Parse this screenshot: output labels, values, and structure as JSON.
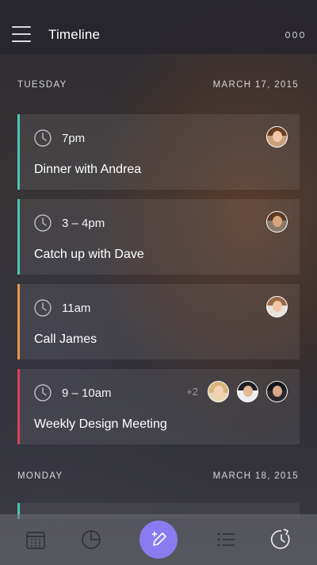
{
  "header": {
    "title": "Timeline",
    "menu_icon": "hamburger-menu-icon",
    "more_icon": "more-options-icon"
  },
  "days": [
    {
      "name": "TUESDAY",
      "date": "MARCH 17, 2015",
      "events": [
        {
          "time": "7pm",
          "title": "Dinner with Andrea",
          "accent": "#4cc4b8",
          "attendees": [
            "andrea-avatar"
          ]
        },
        {
          "time": "3 – 4pm",
          "title": "Catch up with Dave",
          "accent": "#4cc4b8",
          "attendees": [
            "dave-avatar"
          ]
        },
        {
          "time": "11am",
          "title": "Call James",
          "accent": "#e8974a",
          "attendees": [
            "james-avatar"
          ]
        },
        {
          "time": "9 – 10am",
          "title": "Weekly Design Meeting",
          "accent": "#d9405a",
          "extra": "+2",
          "attendees": [
            "attendee-avatar-1",
            "attendee-avatar-2",
            "attendee-avatar-3"
          ]
        }
      ]
    },
    {
      "name": "MONDAY",
      "date": "MARCH 18, 2015"
    }
  ],
  "tabbar": {
    "items": [
      "calendar-icon",
      "pie-chart-icon",
      "compose-icon",
      "list-icon",
      "history-icon"
    ],
    "fab_color": "#8c7bf0"
  },
  "colors": {
    "teal": "#4cc4b8",
    "orange": "#e8974a",
    "red": "#d9405a"
  }
}
